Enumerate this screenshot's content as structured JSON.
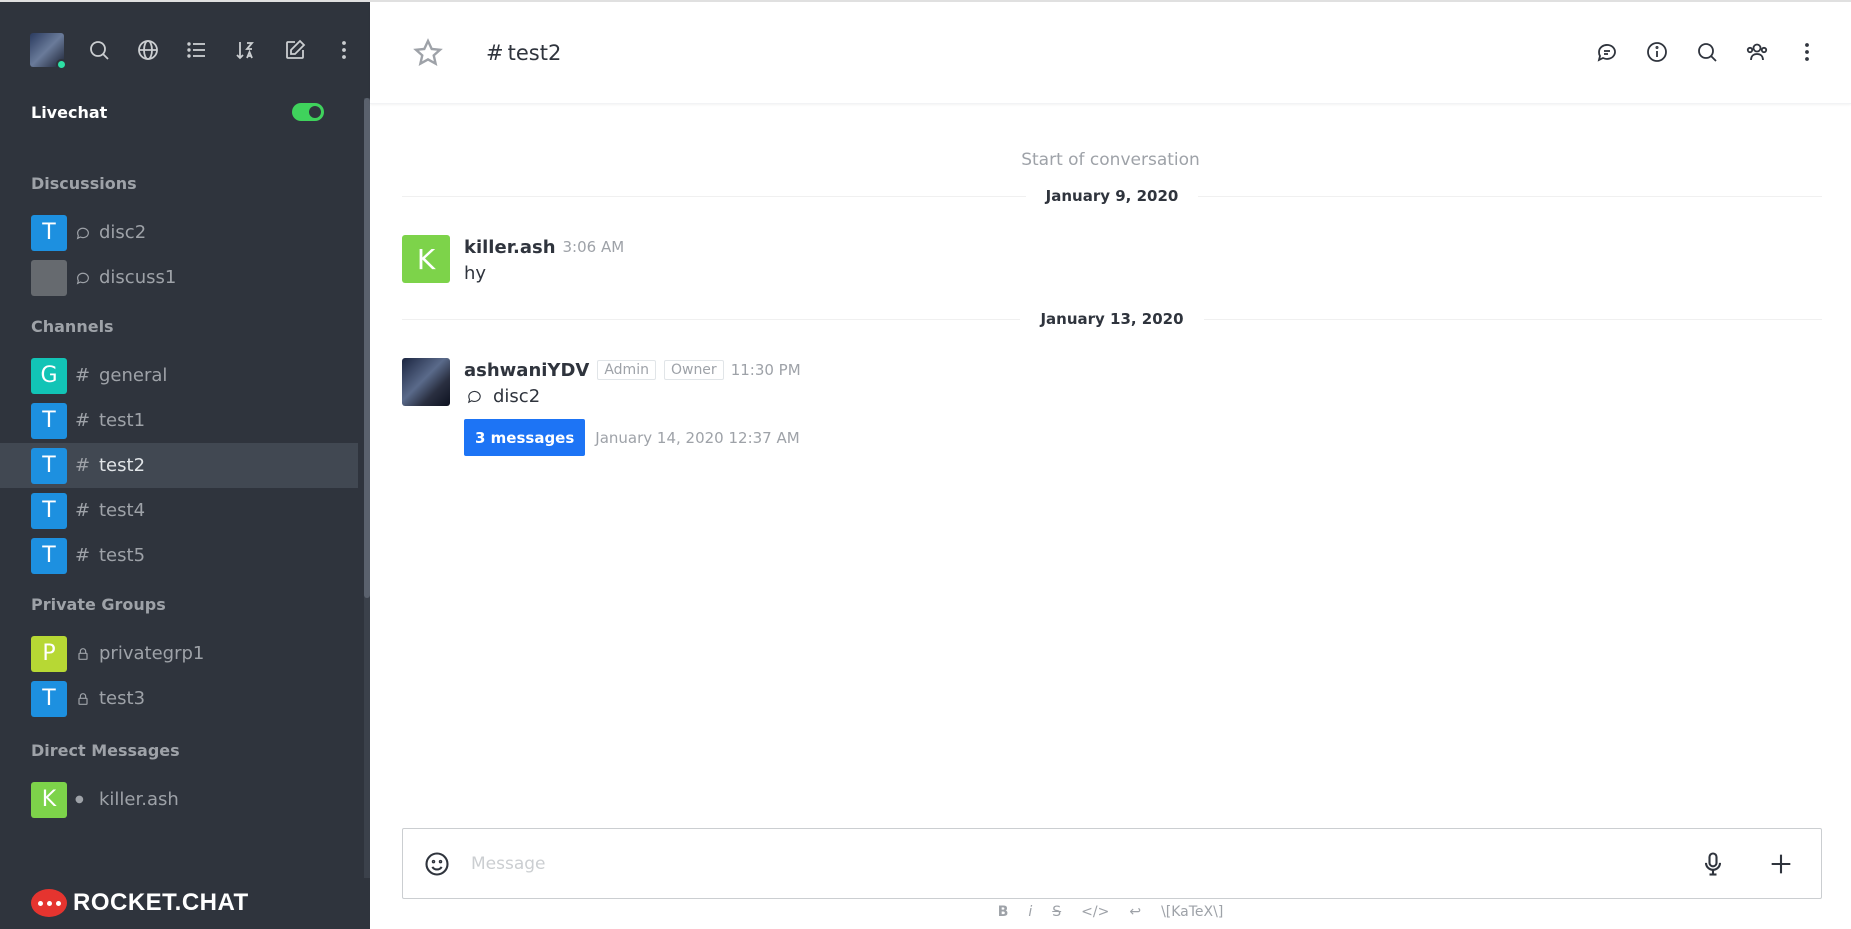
{
  "sidebar": {
    "livechat_label": "Livechat",
    "sections": {
      "discussions": "Discussions",
      "channels": "Channels",
      "private_groups": "Private Groups",
      "direct_messages": "Direct Messages"
    },
    "discussions": [
      {
        "avatar": "T",
        "color": "#1d90e0",
        "name": "disc2"
      },
      {
        "avatar": "",
        "color": "#666a6f",
        "name": "discuss1"
      }
    ],
    "channels": [
      {
        "avatar": "G",
        "color": "#12c4b6",
        "name": "general"
      },
      {
        "avatar": "T",
        "color": "#1d90e0",
        "name": "test1"
      },
      {
        "avatar": "T",
        "color": "#1d90e0",
        "name": "test2"
      },
      {
        "avatar": "T",
        "color": "#1d90e0",
        "name": "test4"
      },
      {
        "avatar": "T",
        "color": "#1d90e0",
        "name": "test5"
      }
    ],
    "private_groups": [
      {
        "avatar": "P",
        "color": "#b7d834",
        "name": "privategrp1"
      },
      {
        "avatar": "T",
        "color": "#1d90e0",
        "name": "test3"
      }
    ],
    "direct_messages": [
      {
        "avatar": "K",
        "color": "#7dd34a",
        "name": "killer.ash"
      }
    ],
    "footer_logo": "ROCKET.CHAT"
  },
  "header": {
    "room_hash": "#",
    "room_name": "test2"
  },
  "messages": {
    "start_label": "Start of conversation",
    "dates": [
      "January 9, 2020",
      "January 13, 2020"
    ],
    "msg1": {
      "avatar": "K",
      "avatar_color": "#7dd34a",
      "user": "killer.ash",
      "time": "3:06 AM",
      "text": "hy"
    },
    "msg2": {
      "user": "ashwaniYDV",
      "roles": [
        "Admin",
        "Owner"
      ],
      "time": "11:30 PM",
      "discussion_name": "disc2",
      "button": "3 messages",
      "last_date": "January 14, 2020 12:37 AM"
    }
  },
  "composer": {
    "placeholder": "Message",
    "formatting": [
      "B",
      "i",
      "S",
      "</>",
      "↩",
      "\\[KaTeX\\]"
    ]
  }
}
